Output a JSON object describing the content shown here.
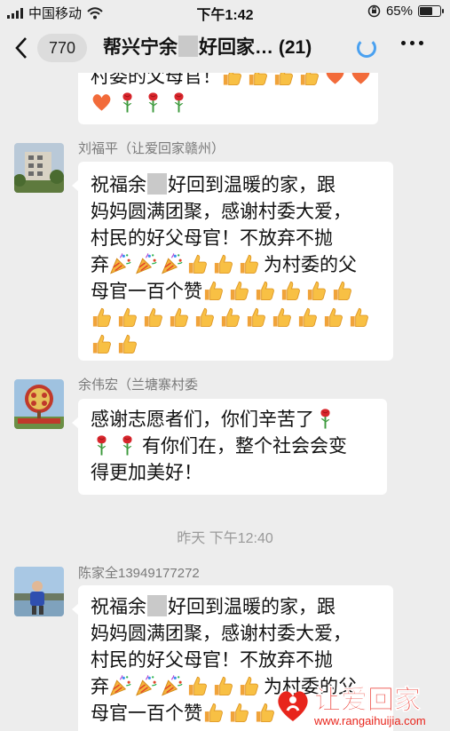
{
  "status_bar": {
    "carrier": "中国移动",
    "time": "下午1:42",
    "battery_percent": "65%",
    "battery_level": 0.65,
    "icons": [
      "signal-icon",
      "wifi-icon",
      "orientation-lock-icon",
      "battery-icon"
    ]
  },
  "nav": {
    "back_icon": "chevron-left-icon",
    "unread_count": "770",
    "title_part1": "帮兴宁余",
    "title_part2": "好回家…",
    "member_count": "(21)",
    "more_icon": "more-icon",
    "loading_icon": "spinner-icon"
  },
  "messages": [
    {
      "id": "msg0",
      "sender": "",
      "lines": [
        "村委的父母官！"
      ],
      "emoji_rows": [
        "thumbs-up-icon x4, heart-icon x2",
        "heart-icon, rose-icon x3"
      ]
    },
    {
      "id": "msg1",
      "sender": "刘福平（让爱回家赣州）",
      "text_line1_a": "祝福余",
      "text_line1_b": "好回到温暖的家，跟",
      "text_line2": "妈妈圆满团聚，感谢村委大爱，",
      "text_line3": "村民的好父母官！不放弃不抛",
      "text_line4_a": "弃",
      "text_line4_b": "为村委的父",
      "text_line5": "母官一百个赞"
    },
    {
      "id": "msg2",
      "sender": "余伟宏（兰塘寨村委",
      "text_line1": "感谢志愿者们，你们辛苦了",
      "text_line2": "有你们在，整个社会会变",
      "text_line3": "得更加美好！"
    },
    {
      "id": "msg3",
      "sender": "陈家全13949177272",
      "text_line1_a": "祝福余",
      "text_line1_b": "好回到温暖的家，跟",
      "text_line2": "妈妈圆满团聚，感谢村委大爱，",
      "text_line3": "村民的好父母官！不放弃不抛",
      "text_line4_a": "弃",
      "text_line4_b": "为村委的父",
      "text_line5": "母官一百个赞"
    }
  ],
  "timestamp": "昨天 下午12:40",
  "watermark": {
    "chinese": "让爱回家",
    "url": "www.rangaihuijia.com",
    "color": "#e8251c"
  },
  "colors": {
    "chat_background": "#ededed",
    "bubble": "#ffffff",
    "spinner": "#4aa1f0"
  }
}
